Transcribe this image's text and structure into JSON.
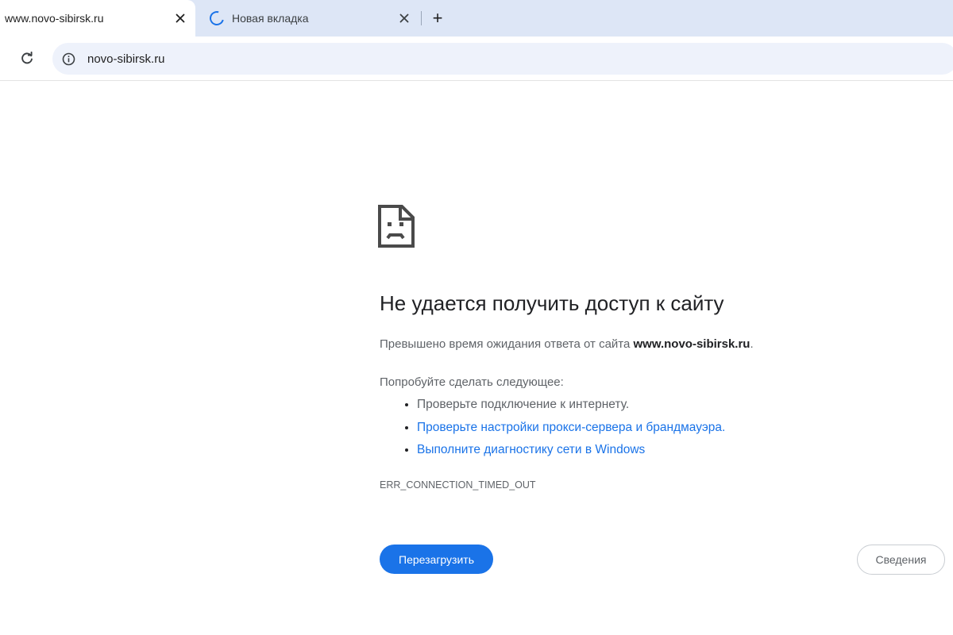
{
  "tabs": [
    {
      "title": "www.novo-sibirsk.ru",
      "active": true,
      "close_icon": "close-icon"
    },
    {
      "title": "Новая вкладка",
      "active": false,
      "loading": true,
      "close_icon": "close-icon"
    }
  ],
  "tabstrip": {
    "new_tab_label": "+"
  },
  "toolbar": {
    "reload_icon": "reload-icon",
    "site_info_icon": "info-icon",
    "url": "novo-sibirsk.ru"
  },
  "error": {
    "icon": "sad-page-icon",
    "title": "Не удается получить доступ к сайту",
    "description_prefix": "Превышено время ожидания ответа от сайта ",
    "description_host": "www.novo-sibirsk.ru",
    "description_suffix": ".",
    "suggestions_heading": "Попробуйте сделать следующее:",
    "suggestions": [
      {
        "text": "Проверьте подключение к интернету.",
        "link": false
      },
      {
        "text": "Проверьте настройки прокси-сервера и брандмауэра.",
        "link": true
      },
      {
        "text": "Выполните диагностику сети в Windows",
        "link": true
      }
    ],
    "code": "ERR_CONNECTION_TIMED_OUT",
    "reload_label": "Перезагрузить",
    "details_label": "Сведения"
  },
  "colors": {
    "accent": "#1a73e8",
    "tabstrip_bg": "#dde6f6",
    "omnibox_bg": "#eef2fb",
    "text_primary": "#202124",
    "text_secondary": "#5f6368"
  }
}
